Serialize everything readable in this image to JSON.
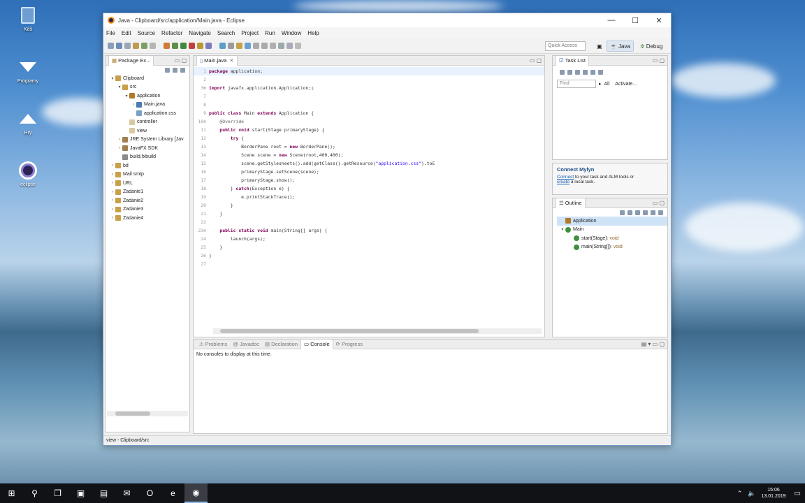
{
  "desktop": {
    "icons": [
      {
        "label": "Kôš",
        "icon": "recycle-bin-icon"
      },
      {
        "label": "Programy",
        "icon": "download-arrow-icon"
      },
      {
        "label": "Hry",
        "icon": "upload-arrow-icon"
      },
      {
        "label": "eclipse",
        "icon": "eclipse-icon"
      }
    ]
  },
  "window": {
    "title": "Java - Clipboard/src/application/Main.java - Eclipse",
    "menu": [
      "File",
      "Edit",
      "Source",
      "Refactor",
      "Navigate",
      "Search",
      "Project",
      "Run",
      "Window",
      "Help"
    ],
    "quick_access": "Quick Access",
    "perspectives": [
      "Java",
      "Debug"
    ]
  },
  "package_explorer": {
    "tab": "Package Ex...",
    "tree": [
      {
        "label": "Clipboard",
        "depth": 0,
        "arrow": "▾",
        "icon": "project"
      },
      {
        "label": "src",
        "depth": 1,
        "arrow": "▾",
        "icon": "source-folder"
      },
      {
        "label": "application",
        "depth": 2,
        "arrow": "▾",
        "icon": "package"
      },
      {
        "label": "Main.java",
        "depth": 3,
        "arrow": "›",
        "icon": "java-file"
      },
      {
        "label": "application.css",
        "depth": 3,
        "arrow": "",
        "icon": "css-file"
      },
      {
        "label": "controller",
        "depth": 2,
        "arrow": "",
        "icon": "package-empty"
      },
      {
        "label": "view",
        "depth": 2,
        "arrow": "",
        "icon": "package-empty"
      },
      {
        "label": "JRE System Library [Jav",
        "depth": 1,
        "arrow": "›",
        "icon": "library"
      },
      {
        "label": "JavaFX SDK",
        "depth": 1,
        "arrow": "›",
        "icon": "library"
      },
      {
        "label": "build.fxbuild",
        "depth": 1,
        "arrow": "",
        "icon": "file"
      },
      {
        "label": "bd",
        "depth": 0,
        "arrow": "›",
        "icon": "project"
      },
      {
        "label": "Mail smtp",
        "depth": 0,
        "arrow": "›",
        "icon": "project"
      },
      {
        "label": "URL",
        "depth": 0,
        "arrow": "›",
        "icon": "project"
      },
      {
        "label": "Zadanie1",
        "depth": 0,
        "arrow": "›",
        "icon": "project"
      },
      {
        "label": "Zadanie2",
        "depth": 0,
        "arrow": "›",
        "icon": "project"
      },
      {
        "label": "Zadanie3",
        "depth": 0,
        "arrow": "›",
        "icon": "project"
      },
      {
        "label": "Zadanie4",
        "depth": 0,
        "arrow": "›",
        "icon": "project"
      }
    ]
  },
  "editor": {
    "tab": "Main.java",
    "lines": [
      {
        "n": "1",
        "html": "<span class='kw'>package</span> application;"
      },
      {
        "n": "2",
        "html": ""
      },
      {
        "n": "3⊕",
        "html": "<span class='kw'>import</span> javafx.application.Application;▯"
      },
      {
        "n": "7",
        "html": ""
      },
      {
        "n": "8",
        "html": ""
      },
      {
        "n": "9",
        "html": "<span class='kw'>public class</span> Main <span class='kw'>extends</span> Application {"
      },
      {
        "n": "10⊖",
        "html": "    <span class='ann'>@Override</span>"
      },
      {
        "n": "11",
        "html": "    <span class='kw'>public void</span> start(Stage primaryStage) {"
      },
      {
        "n": "12",
        "html": "        <span class='kw'>try</span> {"
      },
      {
        "n": "13",
        "html": "            BorderPane root = <span class='kw'>new</span> BorderPane();"
      },
      {
        "n": "14",
        "html": "            Scene scene = <span class='kw'>new</span> Scene(root,400,400);"
      },
      {
        "n": "15",
        "html": "            scene.getStylesheets().add(getClass().getResource(<span class='str'>\"application.css\"</span>).toE"
      },
      {
        "n": "16",
        "html": "            primaryStage.setScene(scene);"
      },
      {
        "n": "17",
        "html": "            primaryStage.show();"
      },
      {
        "n": "18",
        "html": "        } <span class='kw'>catch</span>(Exception e) {"
      },
      {
        "n": "19",
        "html": "            e.printStackTrace();"
      },
      {
        "n": "20",
        "html": "        }"
      },
      {
        "n": "21",
        "html": "    }"
      },
      {
        "n": "22",
        "html": ""
      },
      {
        "n": "23⊖",
        "html": "    <span class='kw'>public static void</span> main(String[] args) {"
      },
      {
        "n": "24",
        "html": "        launch(args);"
      },
      {
        "n": "25",
        "html": "    }"
      },
      {
        "n": "26",
        "html": "}"
      },
      {
        "n": "27",
        "html": ""
      }
    ]
  },
  "task_list": {
    "tab": "Task List",
    "find_placeholder": "Find",
    "all_label": "All",
    "activate_label": "Activate..."
  },
  "mylyn": {
    "title": "Connect Mylyn",
    "connect": "Connect",
    "text1": " to your task and ALM tools or",
    "create": "create",
    "text2": " a local task."
  },
  "outline": {
    "tab": "Outline",
    "items": [
      {
        "label": "application",
        "depth": 0,
        "arrow": "",
        "icon": "package",
        "selected": true,
        "suffix": ""
      },
      {
        "label": "Main",
        "depth": 0,
        "arrow": "▾",
        "icon": "class",
        "selected": false,
        "suffix": ""
      },
      {
        "label": "start(Stage)",
        "depth": 1,
        "arrow": "",
        "icon": "method",
        "selected": false,
        "suffix": " : void"
      },
      {
        "label": "main(String[])",
        "depth": 1,
        "arrow": "",
        "icon": "method-static",
        "selected": false,
        "suffix": " : void"
      }
    ]
  },
  "bottom_panel": {
    "tabs": [
      "Problems",
      "Javadoc",
      "Declaration",
      "Console",
      "Progress"
    ],
    "active_tab": "Console",
    "message": "No consoles to display at this time."
  },
  "status_bar": {
    "text": "view - Clipboard/src"
  },
  "taskbar": {
    "items": [
      {
        "icon": "windows-start-icon",
        "glyph": "⊞"
      },
      {
        "icon": "search-icon",
        "glyph": "⚲"
      },
      {
        "icon": "task-view-icon",
        "glyph": "❐"
      },
      {
        "icon": "store-icon",
        "glyph": "▣"
      },
      {
        "icon": "file-explorer-icon",
        "glyph": "▤"
      },
      {
        "icon": "mail-icon",
        "glyph": "✉"
      },
      {
        "icon": "opera-icon",
        "glyph": "O"
      },
      {
        "icon": "edge-icon",
        "glyph": "e"
      },
      {
        "icon": "eclipse-icon",
        "glyph": "◉"
      }
    ],
    "time": "15:06",
    "date": "13.01.2019"
  },
  "colors": {
    "accent": "#0078d7",
    "keyword": "#7f0055",
    "string": "#2a00ff"
  }
}
